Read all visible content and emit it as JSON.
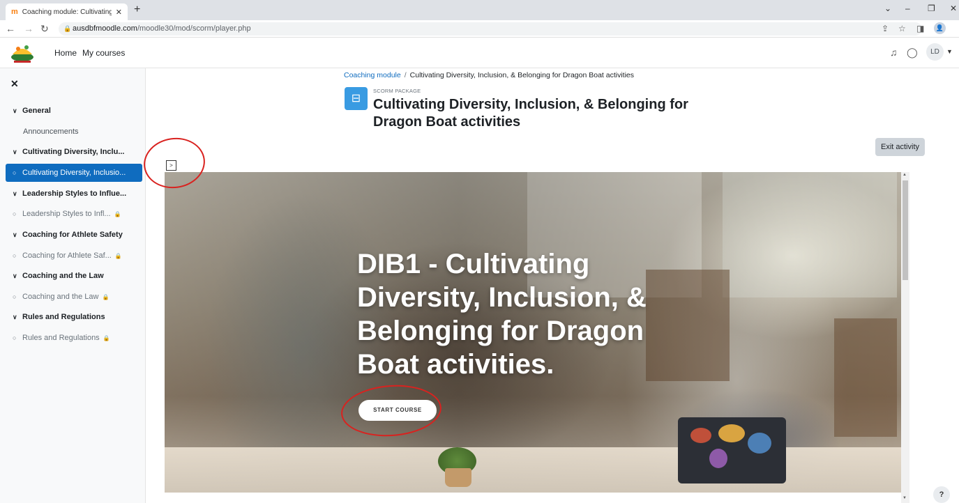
{
  "browser": {
    "tab_title": "Coaching module: Cultivating Di",
    "tab_favicon": "m",
    "tab_close": "✕",
    "new_tab": "+",
    "url_host": "ausdbfmoodle.com",
    "url_path": "/moodle30/mod/scorm/player.php",
    "profile_initials": "👤"
  },
  "header": {
    "nav": [
      "Home",
      "My courses"
    ],
    "user_initials": "LD"
  },
  "sidebar": {
    "close": "✕",
    "items": [
      {
        "type": "section",
        "label": "General"
      },
      {
        "type": "plain",
        "label": "Announcements"
      },
      {
        "type": "section",
        "label": "Cultivating Diversity, Inclu..."
      },
      {
        "type": "active",
        "label": "Cultivating Diversity, Inclusio..."
      },
      {
        "type": "section",
        "label": "Leadership Styles to Influe..."
      },
      {
        "type": "locked",
        "label": "Leadership Styles to Infl..."
      },
      {
        "type": "section",
        "label": "Coaching for Athlete Safety"
      },
      {
        "type": "locked",
        "label": "Coaching for Athlete Saf..."
      },
      {
        "type": "section",
        "label": "Coaching and the Law"
      },
      {
        "type": "locked",
        "label": "Coaching and the Law"
      },
      {
        "type": "section",
        "label": "Rules and Regulations"
      },
      {
        "type": "locked",
        "label": "Rules and Regulations"
      }
    ]
  },
  "main": {
    "breadcrumb": {
      "parent": "Coaching module",
      "separator": "/",
      "current": "Cultivating Diversity, Inclusion, & Belonging for Dragon Boat activities"
    },
    "module_type": "SCORM PACKAGE",
    "title": "Cultivating Diversity, Inclusion, & Belonging for Dragon Boat activities",
    "exit_button": "Exit activity",
    "toc_toggle": ">",
    "scorm": {
      "course_title": "DIB1 - Cultivating Diversity, Inclusion, & Belonging for Dragon Boat activities.",
      "start_button": "START COURSE"
    },
    "help": "?"
  },
  "colors": {
    "accent": "#0f6cbf",
    "module_icon": "#399be2",
    "annotation": "#d9221f"
  }
}
